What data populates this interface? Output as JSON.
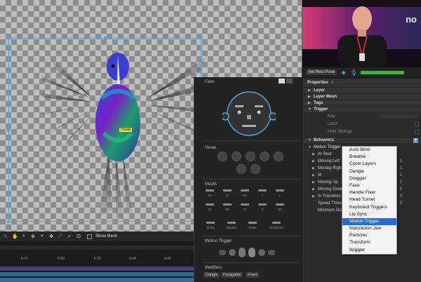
{
  "scene": {
    "head_tag": "Head"
  },
  "webcam": {
    "brand_text": "no",
    "set_rest_pose": "Set Rest Pose"
  },
  "toolbar": {
    "show_mesh": "Show Mesh"
  },
  "timeline": {
    "ticks": [
      "0:21",
      "0:30",
      "0:35",
      "0:40",
      "0:45"
    ]
  },
  "face_panel": {
    "face_title": "Face",
    "views_title": "Views",
    "mouth_title": "Mouth",
    "mouth_shapes_row1": [
      "Ah",
      "D",
      "Ee",
      "F",
      "L"
    ],
    "mouth_shapes_row2": [
      "M",
      "Oh",
      "R",
      "S",
      "Uh"
    ],
    "mouth_shapes_row3": [
      "W-Oo",
      "Neutral",
      "Smile",
      "Surprised"
    ],
    "motion_trigger_title": "Motion Trigger",
    "modifiers_title": "Modifiers",
    "modifiers": [
      "Dangle",
      "Draggable",
      "Fixed"
    ]
  },
  "properties": {
    "title": "Properties",
    "sections": [
      "Layer",
      "Layer Mesh",
      "Tags",
      "Trigger"
    ],
    "trigger_fields": [
      "Key",
      "Latch",
      "Hide Siblings"
    ],
    "behaviors_title": "Behaviors",
    "motion_trigger": "Motion Trigger",
    "behavior_rows": [
      "At Rest",
      "Moving Left",
      "Moving Right",
      "M",
      "Moving Up",
      "Moving Down",
      "In Transition",
      "Speed Thresh",
      "Minimum Du"
    ],
    "value_marks": [
      "1",
      "1",
      "1",
      "1",
      "0",
      "0",
      "0"
    ]
  },
  "dropdown": {
    "items": [
      "Auto Blink",
      "Breathe",
      "Cycle Layers",
      "Dangle",
      "Dragger",
      "Face",
      "Handle Fixer",
      "Head Turner",
      "Keyboard Triggers",
      "Lip Sync",
      "Motion Trigger",
      "Nutcracker Jaw",
      "Particles",
      "Transform",
      "Wiggler"
    ],
    "highlighted": "Motion Trigger"
  },
  "colors": {
    "accent": "#4ea3e0",
    "highlight": "#2a6bd0",
    "meter": "#28c428",
    "head_tag": "#f0e64a"
  }
}
